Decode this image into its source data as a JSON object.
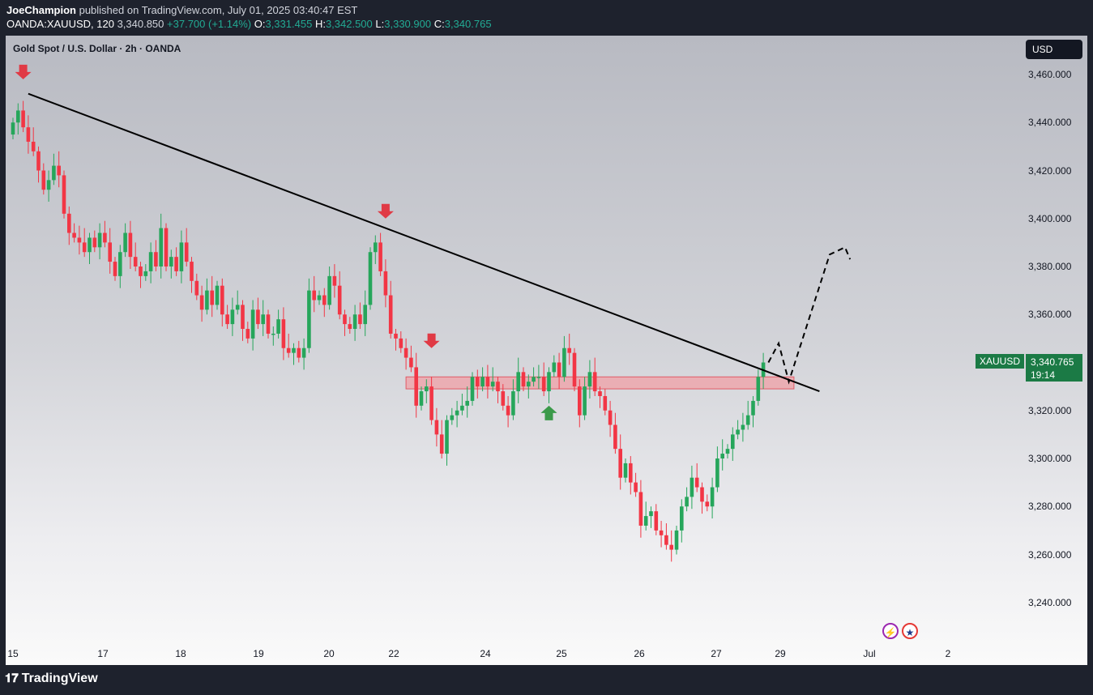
{
  "header": {
    "author": "JoeChampion",
    "published_text": "published on TradingView.com, July 01, 2025 03:40:47 EST",
    "symbol": "OANDA:XAUUSD, 120",
    "last": "3,340.850",
    "change": "+37.700 (+1.14%)",
    "o_label": "O:",
    "o": "3,331.455",
    "h_label": "H:",
    "h": "3,342.500",
    "l_label": "L:",
    "l": "3,330.900",
    "c_label": "C:",
    "c": "3,340.765"
  },
  "chart_title": "Gold Spot / U.S. Dollar · 2h · OANDA",
  "currency_button": "USD",
  "price_tag": {
    "symbol": "XAUUSD",
    "price": "3,340.765",
    "countdown": "19:14"
  },
  "event_icons": {
    "bolt": "lightning-bolt-icon",
    "flag": "us-flag-icon"
  },
  "footer": {
    "logo_glyph": "𝟏𝟕",
    "brand": "TradingView"
  },
  "colors": {
    "up": "#22ab94",
    "up_candle": "#26a65b",
    "down_candle": "#f23645",
    "resistance_zone": "#f0a0a6",
    "trendline": "#000000",
    "marker_red": "#e03a45",
    "marker_green": "#3b9a4a"
  },
  "chart_data": {
    "type": "candlestick",
    "title": "Gold Spot / U.S. Dollar · 2h · OANDA",
    "currency": "USD",
    "y_ticks": [
      3460,
      3440,
      3420,
      3400,
      3380,
      3360,
      3340,
      3320,
      3300,
      3280,
      3260,
      3240
    ],
    "y_tick_labels": [
      "3,460.000",
      "3,440.000",
      "3,420.000",
      "3,400.000",
      "3,380.000",
      "3,360.000",
      "3,340.000",
      "3,320.000",
      "3,300.000",
      "3,280.000",
      "3,260.000",
      "3,240.000"
    ],
    "ylim": [
      3230,
      3480
    ],
    "x_tick_labels": [
      "15",
      "17",
      "18",
      "19",
      "20",
      "22",
      "24",
      "25",
      "26",
      "27",
      "29",
      "Jul",
      "2"
    ],
    "last_price": 3340.765,
    "closes": [
      3440,
      3445,
      3438,
      3432,
      3428,
      3420,
      3412,
      3416,
      3422,
      3418,
      3402,
      3394,
      3392,
      3390,
      3386,
      3392,
      3388,
      3394,
      3390,
      3382,
      3376,
      3386,
      3394,
      3384,
      3380,
      3376,
      3378,
      3386,
      3380,
      3396,
      3380,
      3384,
      3378,
      3390,
      3382,
      3374,
      3368,
      3362,
      3370,
      3364,
      3372,
      3360,
      3356,
      3362,
      3364,
      3354,
      3350,
      3362,
      3356,
      3360,
      3352,
      3352,
      3358,
      3346,
      3344,
      3346,
      3342,
      3346,
      3370,
      3366,
      3368,
      3364,
      3376,
      3372,
      3360,
      3356,
      3354,
      3360,
      3356,
      3364,
      3386,
      3390,
      3378,
      3368,
      3352,
      3350,
      3346,
      3342,
      3338,
      3322,
      3328,
      3330,
      3316,
      3310,
      3302,
      3316,
      3318,
      3320,
      3322,
      3324,
      3334,
      3330,
      3334,
      3330,
      3332,
      3328,
      3322,
      3318,
      3328,
      3336,
      3330,
      3332,
      3334,
      3334,
      3328,
      3336,
      3340,
      3334,
      3346,
      3344,
      3330,
      3318,
      3330,
      3336,
      3328,
      3326,
      3320,
      3314,
      3304,
      3292,
      3298,
      3290,
      3286,
      3272,
      3276,
      3278,
      3270,
      3268,
      3264,
      3262,
      3270,
      3280,
      3284,
      3292,
      3288,
      3282,
      3280,
      3288,
      3300,
      3302,
      3304,
      3310,
      3312,
      3314,
      3318,
      3324,
      3334,
      3340
    ],
    "trendline": {
      "from": [
        3,
        3452
      ],
      "to": [
        158,
        3328
      ]
    },
    "resistance_zone": {
      "from_index": 77,
      "to_index": 153,
      "low": 3329,
      "high": 3334
    },
    "projection": [
      [
        148,
        3340
      ],
      [
        150,
        3348
      ],
      [
        152,
        3332
      ],
      [
        160,
        3385
      ],
      [
        163,
        3388
      ],
      [
        164,
        3383
      ]
    ],
    "markers": [
      {
        "type": "down-arrow",
        "index": 2,
        "price": 3458
      },
      {
        "type": "down-arrow",
        "index": 73,
        "price": 3400
      },
      {
        "type": "down-arrow",
        "index": 82,
        "price": 3346
      },
      {
        "type": "up-arrow",
        "index": 105,
        "price": 3322
      }
    ]
  }
}
